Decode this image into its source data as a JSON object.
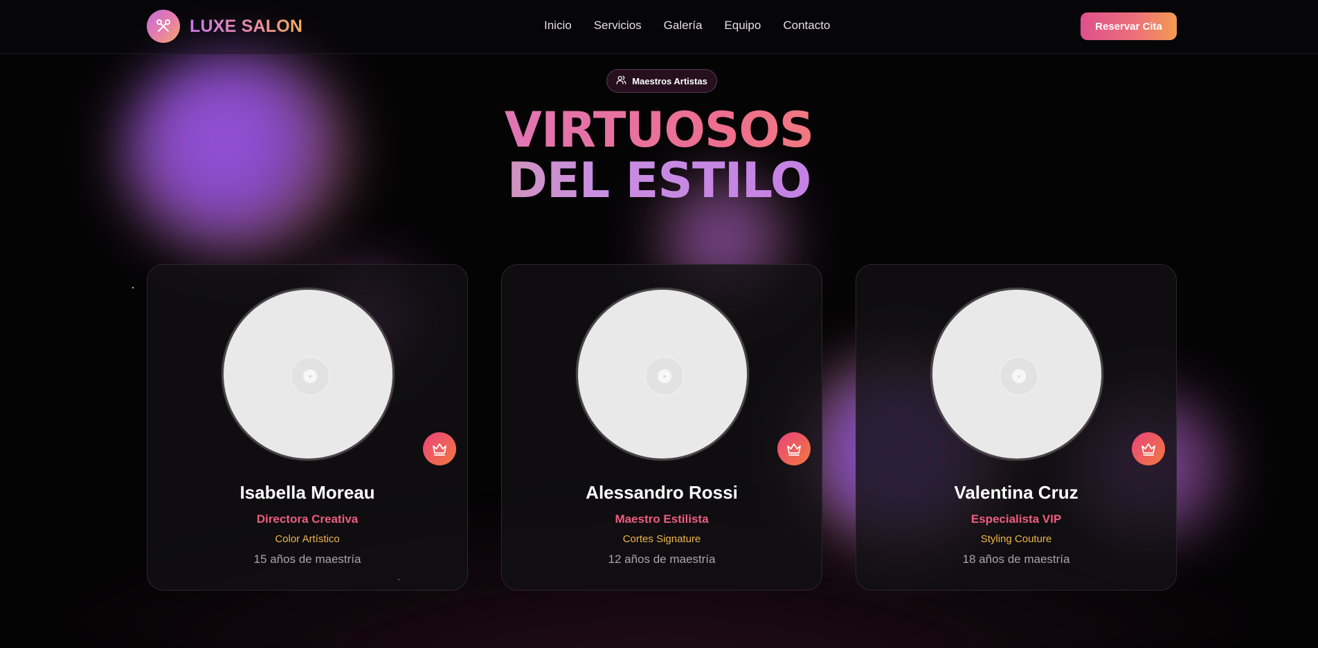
{
  "brand": {
    "name": "LUXE SALON",
    "logo_icon": "scissors-icon"
  },
  "nav": {
    "items": [
      {
        "label": "Inicio"
      },
      {
        "label": "Servicios"
      },
      {
        "label": "Galería"
      },
      {
        "label": "Equipo"
      },
      {
        "label": "Contacto"
      }
    ]
  },
  "header": {
    "cta_label": "Reservar Cita"
  },
  "hero": {
    "badge_label": "Maestros Artistas",
    "badge_icon": "users-icon",
    "title_line_1": "VIRTUOSOS",
    "title_line_2": "DEL ESTILO"
  },
  "team": [
    {
      "name": "Isabella Moreau",
      "role": "Directora Creativa",
      "specialty": "Color Artístico",
      "experience": "15 años de maestría",
      "badge_icon": "crown-icon"
    },
    {
      "name": "Alessandro Rossi",
      "role": "Maestro Estilista",
      "specialty": "Cortes Signature",
      "experience": "12 años de maestría",
      "badge_icon": "crown-icon"
    },
    {
      "name": "Valentina Cruz",
      "role": "Especialista VIP",
      "specialty": "Styling Couture",
      "experience": "18 años de maestría",
      "badge_icon": "crown-icon"
    }
  ],
  "colors": {
    "background": "#050405",
    "accent_pink": "#ee5e7f",
    "accent_gold": "#f2b64a",
    "accent_purple": "#c37de8"
  }
}
